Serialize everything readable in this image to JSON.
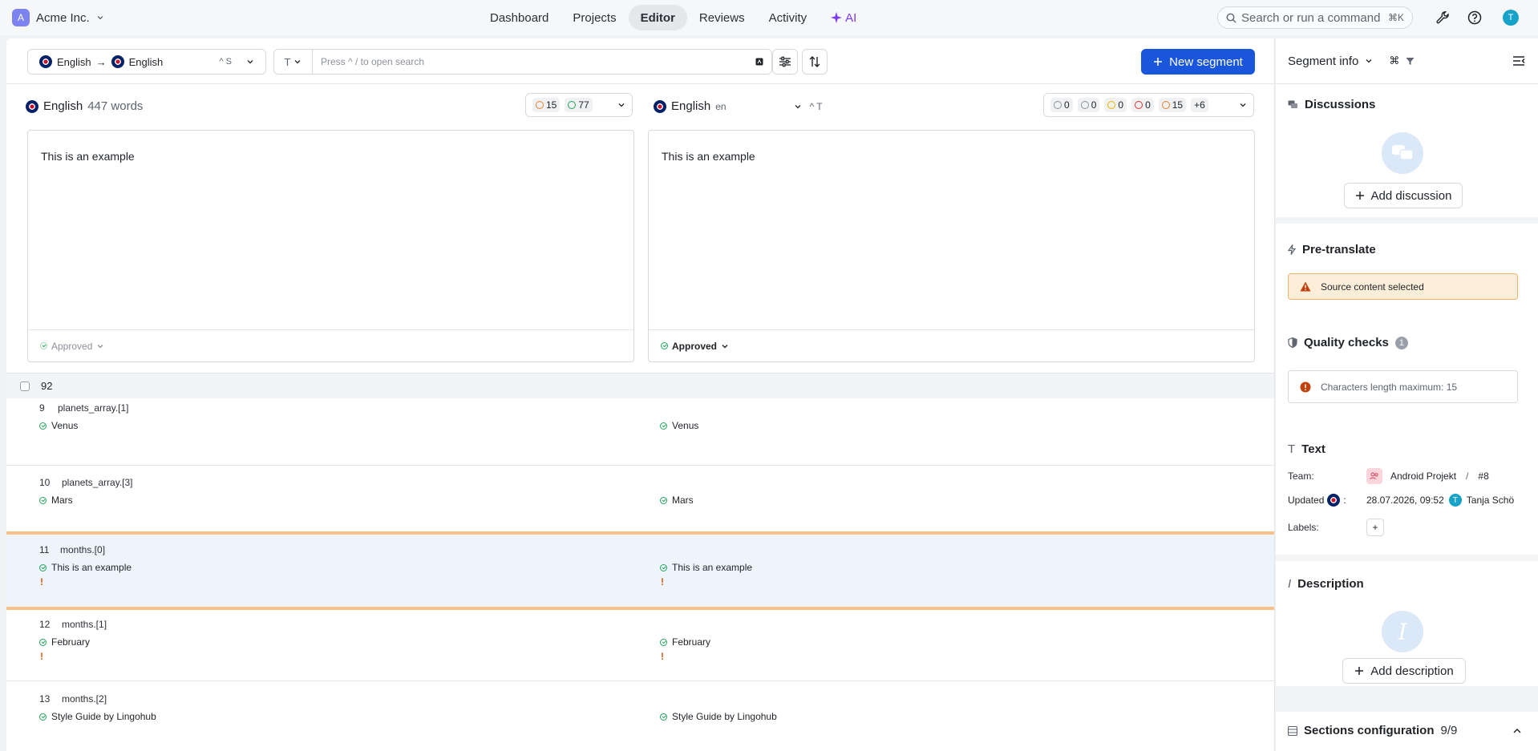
{
  "org": {
    "avatar": "A",
    "name": "Acme Inc."
  },
  "nav": {
    "items": [
      {
        "label": "Dashboard"
      },
      {
        "label": "Projects"
      },
      {
        "label": "Editor"
      },
      {
        "label": "Reviews"
      },
      {
        "label": "Activity"
      },
      {
        "label": "AI"
      }
    ],
    "active": "Editor"
  },
  "command": {
    "placeholder": "Search or run a command",
    "shortcut": "⌘K"
  },
  "user": {
    "avatar": "T"
  },
  "toolbar": {
    "source_lang": "English",
    "arrow": "→",
    "target_lang": "English",
    "lang_shortcut": "^ S",
    "type_icon": "T",
    "search_placeholder": "Press  ^ /  to open search",
    "new_segment": "New segment"
  },
  "source_pane": {
    "lang": "English",
    "words": "447 words",
    "counts": [
      "15",
      "77"
    ],
    "text": "This is an example",
    "status": "Approved"
  },
  "target_pane": {
    "lang": "English",
    "code": "en",
    "shortcut": "^ T",
    "counts": [
      "0",
      "0",
      "0",
      "0",
      "15",
      "+6"
    ],
    "text": "This is an example",
    "status": "Approved"
  },
  "list": {
    "total": "92",
    "rows": [
      {
        "idx": "9",
        "key": "planets_array.[1]",
        "source": "Venus",
        "target": "Venus",
        "warn": false
      },
      {
        "idx": "10",
        "key": "planets_array.[3]",
        "source": "Mars",
        "target": "Mars",
        "warn": false
      },
      {
        "idx": "11",
        "key": "months.[0]",
        "source": "This is an example",
        "target": "This is an example",
        "warn": true
      },
      {
        "idx": "12",
        "key": "months.[1]",
        "source": "February",
        "target": "February",
        "warn": true
      },
      {
        "idx": "13",
        "key": "months.[2]",
        "source": "Style Guide by Lingohub",
        "target": "Style Guide by Lingohub",
        "warn": false
      }
    ],
    "warn_mark": "!"
  },
  "side": {
    "title": "Segment info",
    "shortcut": "⌘",
    "discussions": {
      "title": "Discussions",
      "button": "Add discussion"
    },
    "pretranslate": {
      "title": "Pre-translate",
      "alert": "Source content selected"
    },
    "quality": {
      "title": "Quality checks",
      "count": "1",
      "item": "Characters length maximum: 15"
    },
    "text": {
      "title": "Text",
      "team_label": "Team:",
      "team_value": "Android Projekt",
      "team_sep": "/",
      "team_id": "#8",
      "updated_label": "Updated",
      "updated_colon": ":",
      "updated_value": "28.07.2026, 09:52",
      "updated_user_avatar": "T",
      "updated_user": "Tanja Schö",
      "labels_label": "Labels:",
      "labels_add": "+"
    },
    "description": {
      "title": "Description",
      "button": "Add description",
      "icon_letter": "I"
    },
    "sections": {
      "title": "Sections configuration",
      "count": "9/9"
    }
  }
}
